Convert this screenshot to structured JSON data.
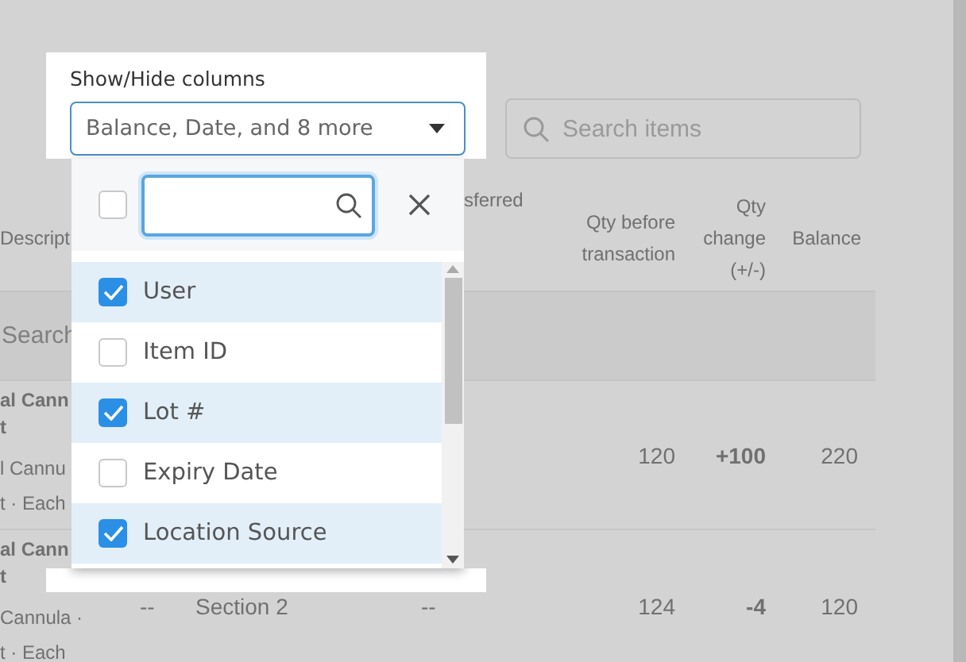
{
  "search": {
    "placeholder": "Search items"
  },
  "table": {
    "columns": [
      {
        "label": "Descript"
      },
      {
        "label": "sferred"
      },
      {
        "label": "Qty before transaction"
      },
      {
        "label": "Qty change (+/-)"
      },
      {
        "label": "Balance"
      }
    ],
    "filter_placeholder": "Search",
    "rows": [
      {
        "name_lines": [
          "al Cann",
          "t"
        ],
        "detail_lines": [
          "l Cannu",
          "t · Each"
        ],
        "qty_before": "120",
        "qty_change": "+100",
        "balance": "220"
      },
      {
        "name_lines": [
          "al Cann",
          "t"
        ],
        "detail_lines": [
          "Cannula ·",
          "t · Each"
        ],
        "column_2": "--",
        "column_3": "Section 2",
        "column_4": "--",
        "qty_before": "124",
        "qty_change": "-4",
        "balance": "120"
      }
    ]
  },
  "column_picker": {
    "label": "Show/Hide columns",
    "value": "Balance, Date, and 8 more",
    "expanded": true,
    "select_all_checked": false,
    "options": [
      {
        "label": "User",
        "checked": true
      },
      {
        "label": "Item ID",
        "checked": false
      },
      {
        "label": "Lot #",
        "checked": true
      },
      {
        "label": "Expiry Date",
        "checked": false
      },
      {
        "label": "Location Source",
        "checked": true
      }
    ]
  }
}
